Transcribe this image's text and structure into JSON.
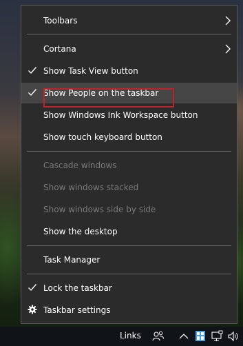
{
  "menu": {
    "items": [
      {
        "label": "Toolbars",
        "checked": false,
        "submenu": true,
        "disabled": false
      },
      {
        "label": "Cortana",
        "checked": false,
        "submenu": true,
        "disabled": false
      },
      {
        "label": "Show Task View button",
        "checked": true,
        "submenu": false,
        "disabled": false
      },
      {
        "label": "Show People on the taskbar",
        "checked": true,
        "submenu": false,
        "disabled": false,
        "highlighted": true
      },
      {
        "label": "Show Windows Ink Workspace button",
        "checked": false,
        "submenu": false,
        "disabled": false
      },
      {
        "label": "Show touch keyboard button",
        "checked": false,
        "submenu": false,
        "disabled": false
      },
      {
        "label": "Cascade windows",
        "checked": false,
        "submenu": false,
        "disabled": true
      },
      {
        "label": "Show windows stacked",
        "checked": false,
        "submenu": false,
        "disabled": true
      },
      {
        "label": "Show windows side by side",
        "checked": false,
        "submenu": false,
        "disabled": true
      },
      {
        "label": "Show the desktop",
        "checked": false,
        "submenu": false,
        "disabled": false
      },
      {
        "label": "Task Manager",
        "checked": false,
        "submenu": false,
        "disabled": false
      },
      {
        "label": "Lock the taskbar",
        "checked": true,
        "submenu": false,
        "disabled": false
      },
      {
        "label": "Taskbar settings",
        "checked": false,
        "submenu": false,
        "disabled": false,
        "icon": "gear-icon"
      }
    ]
  },
  "taskbar": {
    "links_label": "Links",
    "tray_icons": [
      "people-icon",
      "chevron-up-icon",
      "ime-icon",
      "network-icon",
      "volume-icon"
    ]
  },
  "colors": {
    "menu_bg": "#2b2b2b",
    "hover_bg": "#454545",
    "highlight_border": "#c0222b",
    "disabled_text": "#7a7a7a"
  }
}
